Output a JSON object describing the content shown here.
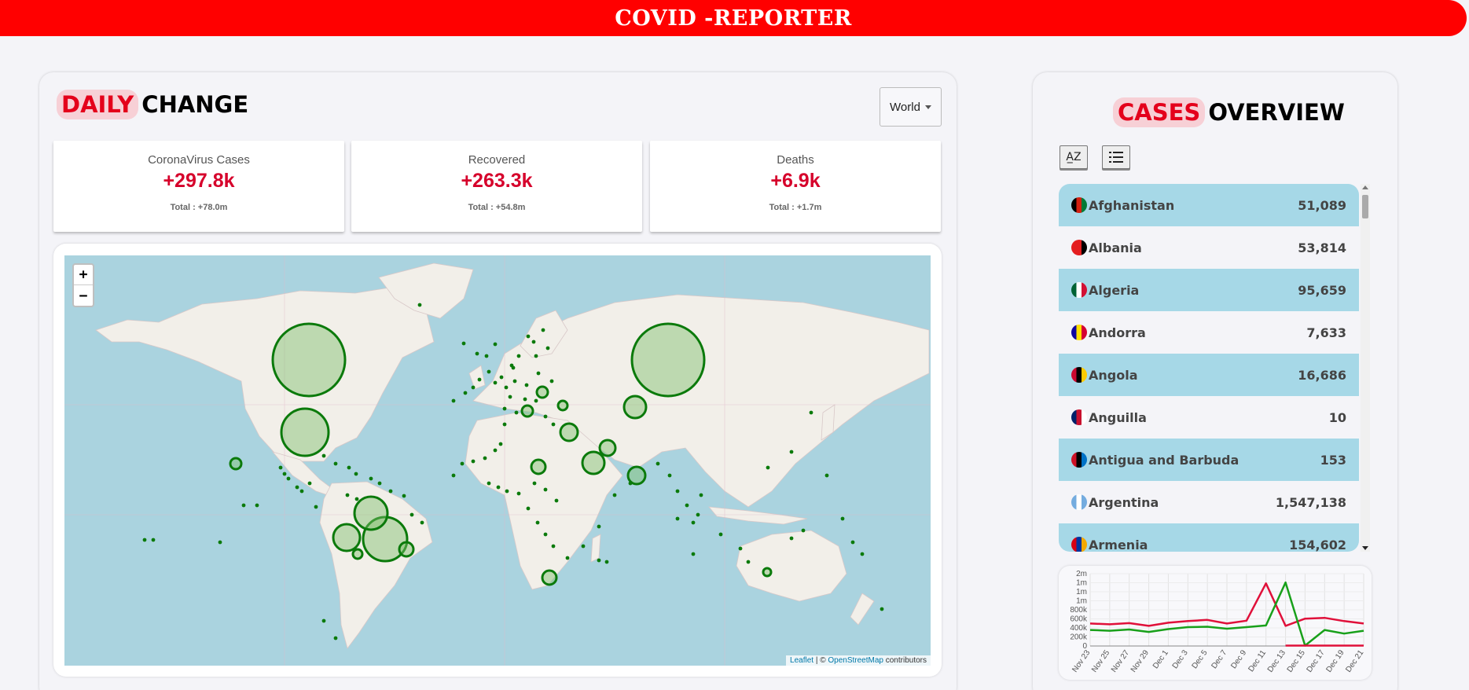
{
  "header": {
    "title": "COVID -REPORTER"
  },
  "daily": {
    "title_highlight": "DAILY",
    "title_rest": "CHANGE",
    "region_select": "World",
    "cards": [
      {
        "label": "CoronaVirus Cases",
        "value": "+297.8k",
        "total": "Total : +78.0m"
      },
      {
        "label": "Recovered",
        "value": "+263.3k",
        "total": "Total : +54.8m"
      },
      {
        "label": "Deaths",
        "value": "+6.9k",
        "total": "Total : +1.7m"
      }
    ]
  },
  "map": {
    "zoom_in": "+",
    "zoom_out": "−",
    "attribution_leaflet": "Leaflet",
    "attribution_sep": " | © ",
    "attribution_osm": "OpenStreetMap",
    "attribution_tail": " contributors",
    "colors": {
      "water": "#aad3df",
      "land": "#f2efe9",
      "marker_stroke": "#0b7a0b",
      "marker_fill": "#7cbf6b"
    }
  },
  "overview": {
    "title_highlight": "CASES",
    "title_rest": "OVERVIEW",
    "sort_alpha_label": "A̲Z",
    "sort_list_icon": "list-icon",
    "countries": [
      {
        "name": "Afghanistan",
        "value": "51,089",
        "flag": [
          "#000000",
          "#d32011",
          "#007a36"
        ]
      },
      {
        "name": "Albania",
        "value": "53,814",
        "flag": [
          "#e41e20",
          "#e41e20",
          "#000000"
        ]
      },
      {
        "name": "Algeria",
        "value": "95,659",
        "flag": [
          "#006233",
          "#ffffff",
          "#d21034"
        ]
      },
      {
        "name": "Andorra",
        "value": "7,633",
        "flag": [
          "#10069f",
          "#fedf00",
          "#d50032"
        ]
      },
      {
        "name": "Angola",
        "value": "16,686",
        "flag": [
          "#cc092f",
          "#000000",
          "#ffcb00"
        ]
      },
      {
        "name": "Anguilla",
        "value": "10",
        "flag": [
          "#012169",
          "#c8102e",
          "#ffffff"
        ]
      },
      {
        "name": "Antigua and Barbuda",
        "value": "153",
        "flag": [
          "#ce1126",
          "#000000",
          "#0072c6"
        ]
      },
      {
        "name": "Argentina",
        "value": "1,547,138",
        "flag": [
          "#74acdf",
          "#ffffff",
          "#74acdf"
        ]
      },
      {
        "name": "Armenia",
        "value": "154,602",
        "flag": [
          "#d90012",
          "#0033a0",
          "#f2a800"
        ]
      }
    ]
  },
  "chart_data": {
    "type": "line",
    "ytick_labels": [
      "2m",
      "1m",
      "1m",
      "1m",
      "800k",
      "600k",
      "400k",
      "200k",
      "0"
    ],
    "ylim": [
      0,
      1800000
    ],
    "x": [
      "Nov 23",
      "Nov 25",
      "Nov 27",
      "Nov 29",
      "Dec 1",
      "Dec 3",
      "Dec 5",
      "Dec 7",
      "Dec 9",
      "Dec 11",
      "Dec 13",
      "Dec 15",
      "Dec 17",
      "Dec 19",
      "Dec 21"
    ],
    "series": [
      {
        "color": "#e0103a",
        "values": [
          560000,
          540000,
          570000,
          500000,
          580000,
          620000,
          650000,
          560000,
          630000,
          1560000,
          500000,
          680000,
          700000,
          620000,
          560000
        ]
      },
      {
        "color": "#18a01a",
        "values": [
          400000,
          380000,
          410000,
          350000,
          420000,
          470000,
          480000,
          430000,
          470000,
          510000,
          1580000,
          10000,
          400000,
          310000,
          380000
        ]
      },
      {
        "color": "#e0103a",
        "values": [
          null,
          null,
          null,
          null,
          null,
          null,
          null,
          null,
          null,
          null,
          10000,
          10000,
          10000,
          10000,
          10000
        ]
      }
    ]
  }
}
